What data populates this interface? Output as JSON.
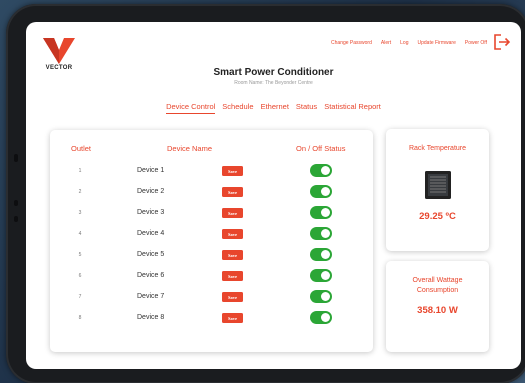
{
  "brand": {
    "name": "VECTOR",
    "accent": "#e8462d"
  },
  "top_nav": [
    {
      "label": "Change Password"
    },
    {
      "label": "Alert"
    },
    {
      "label": "Log"
    },
    {
      "label": "Update Firmware"
    },
    {
      "label": "Power Off"
    }
  ],
  "header": {
    "title": "Smart Power Conditioner",
    "room_name": "Room Name: The Beyonder Centre"
  },
  "tabs": [
    {
      "label": "Device Control",
      "active": true
    },
    {
      "label": "Schedule",
      "active": false
    },
    {
      "label": "Ethernet",
      "active": false
    },
    {
      "label": "Status",
      "active": false
    },
    {
      "label": "Statistical Report",
      "active": false
    }
  ],
  "outlet_table": {
    "headers": {
      "outlet": "Outlet",
      "device_name": "Device Name",
      "status": "On / Off Status"
    },
    "save_label": "Save",
    "rows": [
      {
        "outlet": "1",
        "device": "Device 1",
        "on": true
      },
      {
        "outlet": "2",
        "device": "Device 2",
        "on": true
      },
      {
        "outlet": "3",
        "device": "Device 3",
        "on": true
      },
      {
        "outlet": "4",
        "device": "Device 4",
        "on": true
      },
      {
        "outlet": "5",
        "device": "Device 5",
        "on": true
      },
      {
        "outlet": "6",
        "device": "Device 6",
        "on": true
      },
      {
        "outlet": "7",
        "device": "Device 7",
        "on": true
      },
      {
        "outlet": "8",
        "device": "Device 8",
        "on": true
      }
    ]
  },
  "rack_temperature": {
    "title": "Rack Temperature",
    "value": "29.25 ºC",
    "icon": "server-rack-icon"
  },
  "wattage": {
    "title_line1": "Overall Wattage",
    "title_line2": "Consumption",
    "value": "358.10 W"
  },
  "colors": {
    "accent": "#e8462d",
    "toggle_on": "#2ba636"
  }
}
